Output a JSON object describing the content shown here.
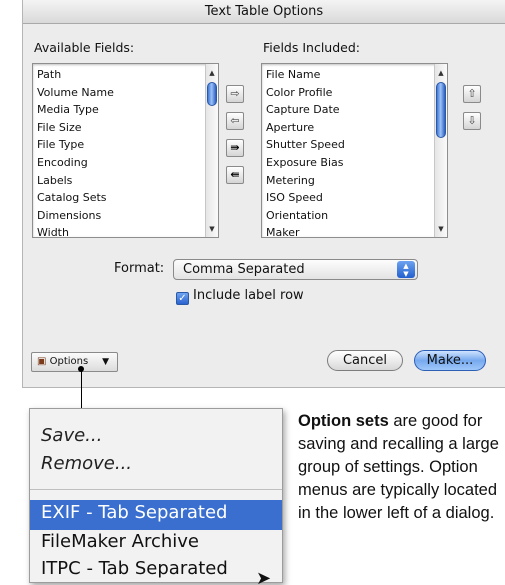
{
  "dialog": {
    "title": "Text Table Options",
    "available_label": "Available Fields:",
    "included_label": "Fields Included:",
    "available_fields": [
      "Path",
      "Volume Name",
      "Media Type",
      "File Size",
      "File Type",
      "Encoding",
      "Labels",
      "Catalog Sets",
      "Dimensions",
      "Width"
    ],
    "included_fields": [
      "File Name",
      "Color Profile",
      "Capture Date",
      "Aperture",
      "Shutter Speed",
      "Exposure Bias",
      "Metering",
      "ISO Speed",
      "Orientation",
      "Maker"
    ],
    "format_label": "Format:",
    "format_value": "Comma Separated",
    "include_label_row": "Include label row",
    "include_label_row_checked": true,
    "options_button": "Options",
    "cancel_button": "Cancel",
    "make_button": "Make..."
  },
  "menu": {
    "items": [
      "Save...",
      "Remove...",
      "EXIF - Tab Separated",
      "FileMaker Archive",
      "ITPC - Tab Separated"
    ],
    "highlighted_index": 2,
    "highlight_color": "#3a6fcf"
  },
  "caption": {
    "bold": "Option sets",
    "text": " are good for saving and recalling a large group of settings. Option menus are typically located in the lower left of a dialog."
  },
  "icons": {
    "move_right": "right-arrow-icon",
    "move_left": "left-arrow-icon",
    "move_all_right": "double-right-arrow-icon",
    "move_all_left": "double-left-arrow-icon",
    "move_up": "up-arrow-icon",
    "move_down": "down-arrow-icon",
    "options": "folder-icon",
    "cursor": "mouse-pointer-icon"
  }
}
